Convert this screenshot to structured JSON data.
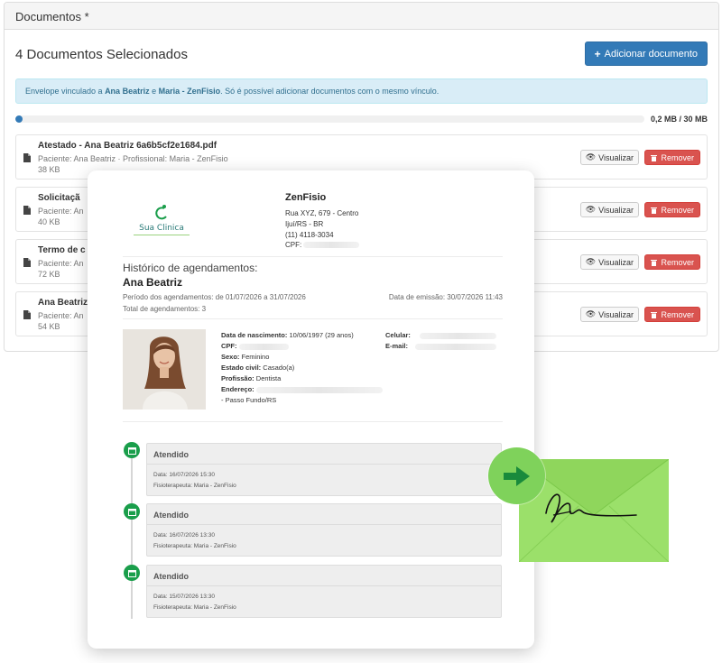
{
  "panel": {
    "heading": "Documentos *",
    "count_title": "4 Documentos Selecionados",
    "add_button": "Adicionar documento",
    "alert": {
      "prefix": "Envelope vinculado a ",
      "name1": "Ana Beatriz",
      "joiner": " e ",
      "name2": "Maria - ZenFisio",
      "suffix": ". Só é possível adicionar documentos com o mesmo vínculo."
    },
    "storage": {
      "label": "0,2 MB / 30 MB",
      "used_fraction": 0.0067
    },
    "view_label": "Visualizar",
    "remove_label": "Remover",
    "documents": [
      {
        "name": "Atestado - Ana Beatriz 6a6b5cf2e1684.pdf",
        "meta": "Paciente: Ana Beatriz · Profissional: Maria - ZenFisio",
        "size": "38 KB"
      },
      {
        "name": "Solicitaçã",
        "meta": "Paciente: An",
        "size": "40 KB"
      },
      {
        "name": "Termo de c",
        "meta": "Paciente: An",
        "size": "72 KB"
      },
      {
        "name": "Ana Beatriz",
        "meta": "Paciente: An",
        "size": "54 KB"
      }
    ]
  },
  "report": {
    "logo_text": "Sua Clinica",
    "clinic": {
      "name": "ZenFisio",
      "address1": "Rua XYZ, 679 - Centro",
      "address2": "Ijuí/RS - BR",
      "phone": "(11) 4118-3034",
      "cpf_label": "CPF:"
    },
    "title": "Histórico de agendamentos:",
    "patient": "Ana Beatriz",
    "period": "Período dos agendamentos: de 01/07/2026 a 31/07/2026",
    "total": "Total de agendamentos: 3",
    "emission": "Data de emissão: 30/07/2026 11:43",
    "info": {
      "birth_label": "Data de nascimento:",
      "birth_value": "10/06/1997 (29 anos)",
      "cpf_label": "CPF:",
      "sex_label": "Sexo:",
      "sex_value": "Feminino",
      "civil_label": "Estado civil:",
      "civil_value": "Casado(a)",
      "prof_label": "Profissão:",
      "prof_value": "Dentista",
      "addr_label": "Endereço:",
      "city": "- Passo Fundo/RS",
      "cell_label": "Celular:",
      "email_label": "E-mail:"
    },
    "appointments": [
      {
        "status": "Atendido",
        "date": "Data: 16/07/2026 15:30",
        "therapist": "Fisioterapeuta: Maria - ZenFisio"
      },
      {
        "status": "Atendido",
        "date": "Data: 16/07/2026 13:30",
        "therapist": "Fisioterapeuta: Maria - ZenFisio"
      },
      {
        "status": "Atendido",
        "date": "Data: 15/07/2026 13:30",
        "therapist": "Fisioterapeuta: Maria - ZenFisio"
      }
    ]
  },
  "colors": {
    "primary": "#337ab7",
    "danger": "#d9534f",
    "info_bg": "#d9edf7",
    "timeline_green": "#1a9e4b",
    "envelope_green": "#9be06a"
  },
  "icons": [
    "file-icon",
    "eye-icon",
    "trash-icon",
    "plus-icon",
    "calendar-icon",
    "arrow-right-icon",
    "signature-icon",
    "envelope-icon"
  ]
}
